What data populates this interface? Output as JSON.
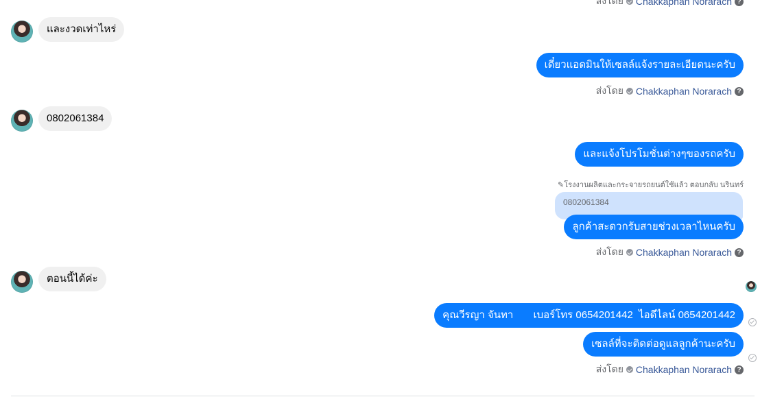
{
  "top_sent_by": {
    "prefix": "ส่งโดย",
    "name": "Chakkaphan Norarach",
    "help": "?"
  },
  "messages": [
    {
      "text": "และงวดเท่าไหร่"
    },
    {
      "text": "เดี๋ยวแอดมินให้เซลล์แจ้งรายละเอียดนะครับ"
    },
    {
      "text": "0802061384"
    },
    {
      "text": "และแจ้งโปรโมชั่นต่างๆของรถครับ"
    },
    {
      "text": "ลูกค้าสะดวกรับสายช่วงเวลาไหนครับ"
    },
    {
      "text": "ตอนนี้ได้ค่ะ"
    },
    {
      "text": "คุณวีรญา จันทา       เบอร์โทร 0654201442  ไอดีไลน์ 0654201442"
    },
    {
      "text": "เซลล์ที่จะติดต่อดูแลลูกค้านะครับ"
    }
  ],
  "sent_by": {
    "prefix": "ส่งโดย",
    "name": "Chakkaphan Norarach",
    "help": "?"
  },
  "reply": {
    "note": "โรงงานผลิตและกระจายรถยนต์ใช้แล้ว ตอบกลับ นรินทร์",
    "quoted_text": "0802061384"
  }
}
